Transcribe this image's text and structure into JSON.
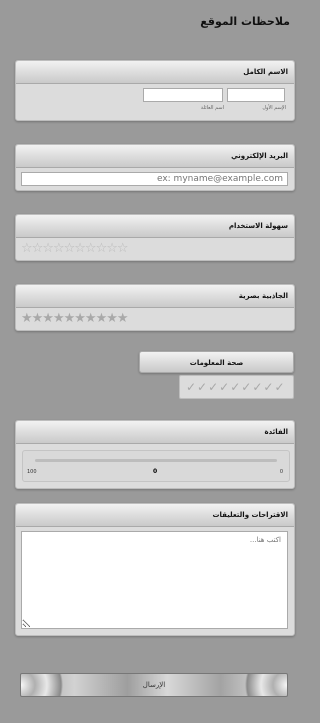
{
  "page": {
    "title": "ملاحظات الموقع"
  },
  "full_name": {
    "label": "الاسم الكامل",
    "first_sublabel": "الإسم الأول",
    "last_sublabel": "اسم العائلة",
    "first_value": "",
    "last_value": ""
  },
  "email": {
    "label": "البريد الإلكتروني",
    "placeholder": "ex: myname@example.com"
  },
  "ease_of_use": {
    "label": "سهولة الاستخدام",
    "rating": 0,
    "max": 10,
    "stars": "☆☆☆☆☆☆☆☆☆☆"
  },
  "visual_appeal": {
    "label": "الجاذبية بصرية",
    "rating": 0,
    "max": 10,
    "stars": "★★★★★★★★★★"
  },
  "info_accuracy": {
    "label": "صحة المعلومات",
    "marks": "✓✓✓✓✓✓✓✓✓"
  },
  "usefulness": {
    "label": "الفائدة",
    "min": "0",
    "max": "100",
    "value": "0",
    "value_fraction": 0.5
  },
  "comments": {
    "label": "الاقتراحات والتعليقات",
    "placeholder": "اكتب هنا..."
  },
  "submit": {
    "label": "الإرسال"
  }
}
